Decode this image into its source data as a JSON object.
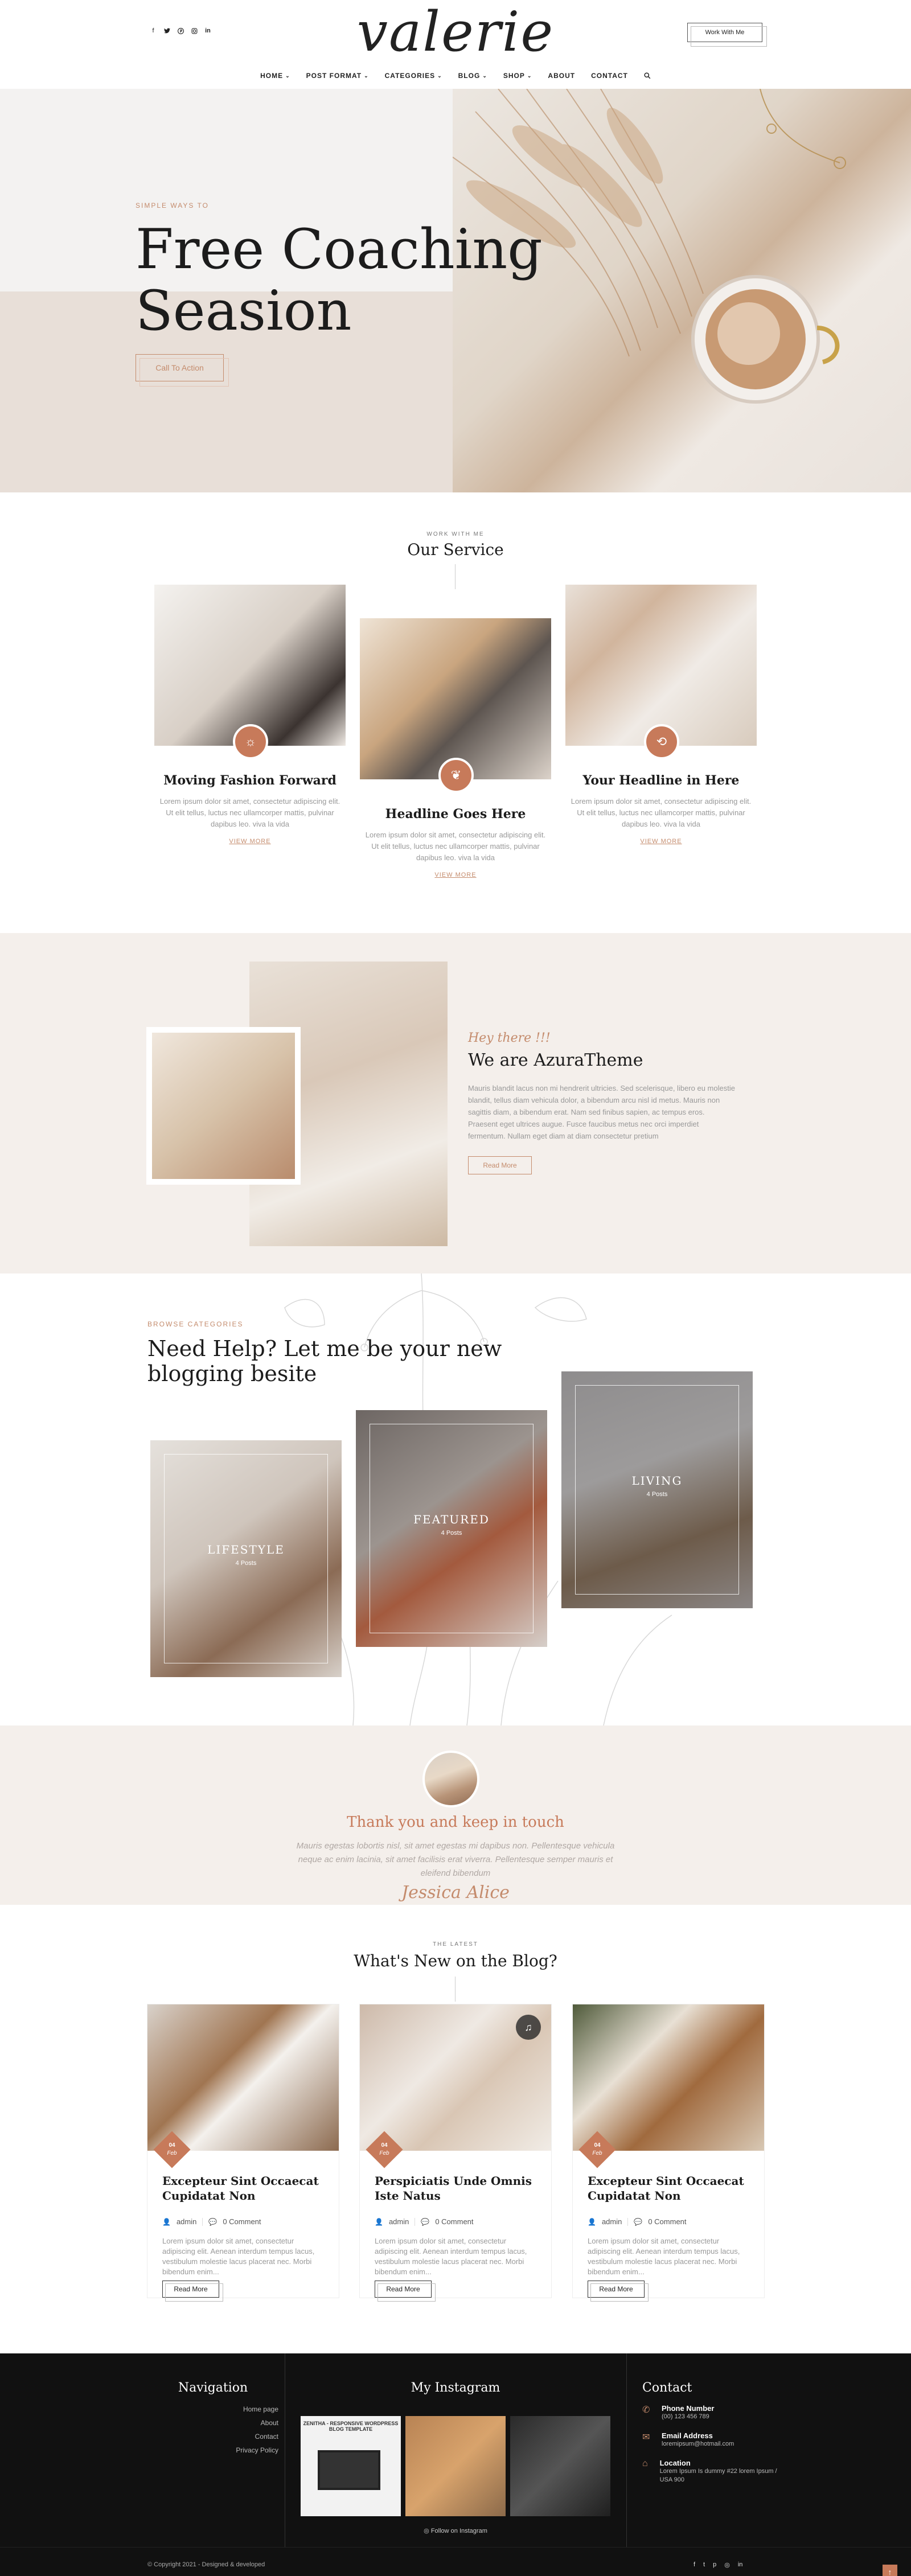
{
  "header": {
    "logo": "valerie",
    "work_button": "Work With Me",
    "social_icons": [
      "facebook-icon",
      "twitter-icon",
      "pinterest-icon",
      "instagram-icon",
      "linkedin-icon"
    ],
    "nav": [
      {
        "label": "HOME",
        "dropdown": true
      },
      {
        "label": "POST FORMAT",
        "dropdown": true
      },
      {
        "label": "CATEGORIES",
        "dropdown": true
      },
      {
        "label": "BLOG",
        "dropdown": true
      },
      {
        "label": "SHOP",
        "dropdown": true
      },
      {
        "label": "ABOUT",
        "dropdown": false
      },
      {
        "label": "CONTACT",
        "dropdown": false
      }
    ]
  },
  "hero": {
    "kicker": "SIMPLE WAYS TO",
    "title": "Free Coaching Seasion",
    "button": "Call To Action"
  },
  "service": {
    "kicker": "WORK WITH ME",
    "title": "Our Service",
    "cards": [
      {
        "title": "Moving Fashion Forward",
        "text": "Lorem ipsum dolor sit amet, consectetur adipiscing elit. Ut elit tellus, luctus nec ullamcorper mattis, pulvinar dapibus leo. viva la vida",
        "more": "VIEW MORE"
      },
      {
        "title": "Headline Goes Here",
        "text": "Lorem ipsum dolor sit amet, consectetur adipiscing elit. Ut elit tellus, luctus nec ullamcorper mattis, pulvinar dapibus leo. viva la vida",
        "more": "VIEW MORE"
      },
      {
        "title": "Your Headline in Here",
        "text": "Lorem ipsum dolor sit amet, consectetur adipiscing elit. Ut elit tellus, luctus nec ullamcorper mattis, pulvinar dapibus leo. viva la vida",
        "more": "VIEW MORE"
      }
    ]
  },
  "about": {
    "script": "Hey there !!!",
    "title": "We are AzuraTheme",
    "text": "Mauris blandit lacus non mi hendrerit ultricies. Sed scelerisque, libero eu molestie blandit, tellus diam vehicula dolor, a bibendum arcu nisl id metus. Mauris non sagittis diam, a bibendum erat. Nam sed finibus sapien, ac tempus eros. Praesent eget ultrices augue. Fusce faucibus metus nec orci imperdiet fermentum. Nullam eget diam at diam consectetur pretium",
    "button": "Read More"
  },
  "categories": {
    "kicker": "BROWSE CATEGORIES",
    "title": "Need Help? Let me be your new blogging besite",
    "cards": [
      {
        "name": "LIFESTYLE",
        "count": "4 Posts"
      },
      {
        "name": "FEATURED",
        "count": "4 Posts"
      },
      {
        "name": "LIVING",
        "count": "4 Posts"
      }
    ]
  },
  "thanks": {
    "title": "Thank you and keep in touch",
    "text": "Mauris egestas lobortis nisl, sit amet egestas mi dapibus non. Pellentesque vehicula neque ac enim lacinia, sit amet facilisis erat viverra. Pellentesque semper mauris et eleifend bibendum",
    "signature": "Jessica Alice"
  },
  "blog": {
    "kicker": "THE LATEST",
    "title": "What's New on the Blog?",
    "posts": [
      {
        "date_day": "04",
        "date_month": "Feb",
        "title": "Excepteur Sint Occaecat Cupidatat Non",
        "author": "admin",
        "comments": "0 Comment",
        "text": "Lorem ipsum dolor sit amet, consectetur adipiscing elit. Aenean interdum tempus lacus, vestibulum molestie lacus placerat nec. Morbi bibendum enim...",
        "button": "Read More"
      },
      {
        "date_day": "04",
        "date_month": "Feb",
        "title": "Perspiciatis Unde Omnis Iste Natus",
        "author": "admin",
        "comments": "0 Comment",
        "text": "Lorem ipsum dolor sit amet, consectetur adipiscing elit. Aenean interdum tempus lacus, vestibulum molestie lacus placerat nec. Morbi bibendum enim...",
        "button": "Read More"
      },
      {
        "date_day": "04",
        "date_month": "Feb",
        "title": "Excepteur Sint Occaecat Cupidatat Non",
        "author": "admin",
        "comments": "0 Comment",
        "text": "Lorem ipsum dolor sit amet, consectetur adipiscing elit. Aenean interdum tempus lacus, vestibulum molestie lacus placerat nec. Morbi bibendum enim...",
        "button": "Read More"
      }
    ]
  },
  "footer": {
    "nav_title": "Navigation",
    "nav_links": [
      "Home page",
      "About",
      "Contact",
      "Privacy Policy"
    ],
    "insta_title": "My Instagram",
    "insta_follow": "Follow on Instagram",
    "insta_caption": "ZENITHA - RESPONSIVE WORDPRESS BLOG TEMPLATE",
    "contact_title": "Contact",
    "contacts": [
      {
        "label": "Phone Number",
        "value": "(00) 123 456 789",
        "icon": "phone-icon"
      },
      {
        "label": "Email Address",
        "value": "loremipsum@hotmail.com",
        "icon": "mail-icon"
      },
      {
        "label": "Location",
        "value": "Lorem Ipsum Is dummy #22 lorem Ipsum / USA 900",
        "icon": "location-icon"
      }
    ],
    "copyright": "© Copyright 2021 - Designed & developed",
    "colors": {
      "accent": "#c77a5a",
      "dark": "#111111"
    }
  }
}
